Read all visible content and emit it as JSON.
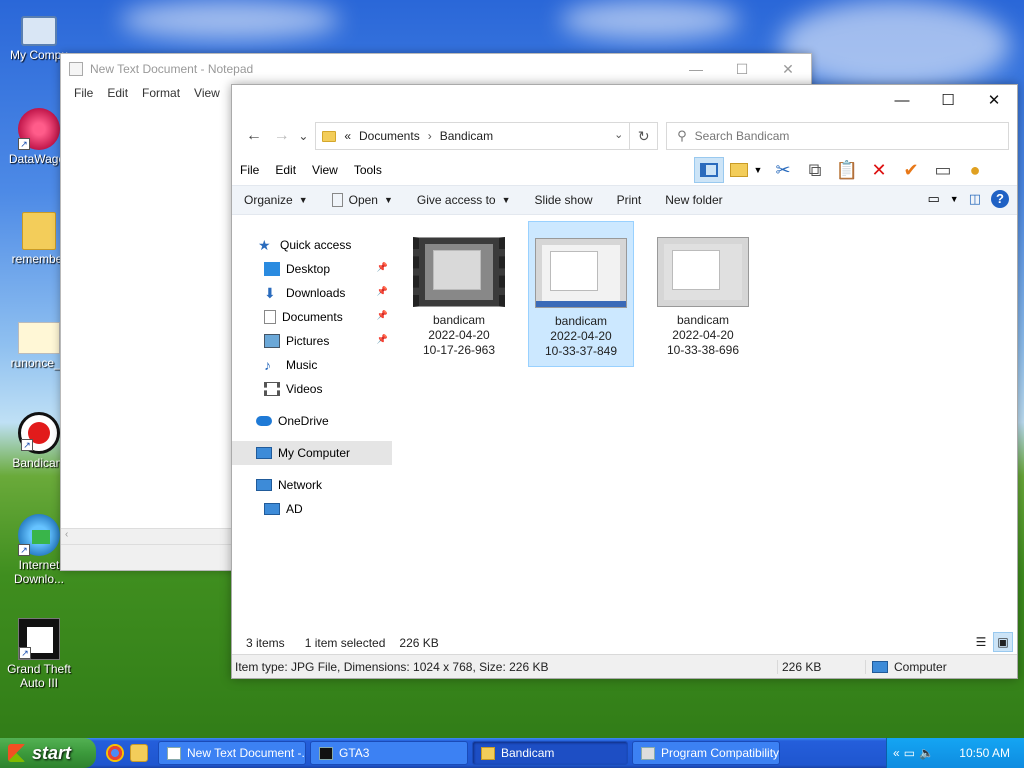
{
  "desktop": {
    "icons": [
      {
        "label": "My Compu"
      },
      {
        "label": "DataWagor"
      },
      {
        "label": "remember"
      },
      {
        "label": "runonce_5"
      },
      {
        "label": "Bandicam"
      },
      {
        "label": "Internet\nDownlo..."
      },
      {
        "label": "Grand Theft\nAuto III"
      }
    ]
  },
  "notepad": {
    "title": "New Text Document - Notepad",
    "menu": [
      "File",
      "Edit",
      "Format",
      "View",
      "H"
    ],
    "controls": {
      "minimize": "—",
      "maximize": "☐",
      "close": "✕"
    }
  },
  "explorer": {
    "controls": {
      "minimize": "—",
      "maximize": "☐",
      "close": "✕"
    },
    "nav": {
      "back": "←",
      "forward": "→",
      "recent": "⌄",
      "refresh": "↻"
    },
    "address": {
      "overflow": "«",
      "crumbs": [
        "Documents",
        "Bandicam"
      ],
      "separator": "›"
    },
    "search": {
      "placeholder": "Search Bandicam",
      "icon": "search-icon"
    },
    "menu": [
      "File",
      "Edit",
      "View",
      "Tools"
    ],
    "toolbar_icons": [
      "preview-pane-icon",
      "folder-options-icon",
      "cut-icon",
      "copy-icon",
      "paste-icon",
      "delete-icon",
      "check-icon",
      "properties-icon",
      "shell-icon"
    ],
    "commands": [
      {
        "label": "Organize",
        "dropdown": true
      },
      {
        "label": "Open",
        "dropdown": true
      },
      {
        "label": "Give access to",
        "dropdown": true
      },
      {
        "label": "Slide show",
        "dropdown": false
      },
      {
        "label": "Print",
        "dropdown": false
      },
      {
        "label": "New folder",
        "dropdown": false
      }
    ],
    "help": "?",
    "nav_pane": [
      {
        "label": "Quick access",
        "icon": "star-icon",
        "indent": 1,
        "pinned": false
      },
      {
        "label": "Desktop",
        "icon": "desktop-icon",
        "indent": 2,
        "pinned": true
      },
      {
        "label": "Downloads",
        "icon": "download-icon",
        "indent": 2,
        "pinned": true
      },
      {
        "label": "Documents",
        "icon": "document-icon",
        "indent": 2,
        "pinned": true
      },
      {
        "label": "Pictures",
        "icon": "pictures-icon",
        "indent": 2,
        "pinned": true
      },
      {
        "label": "Music",
        "icon": "music-icon",
        "indent": 2,
        "pinned": false
      },
      {
        "label": "Videos",
        "icon": "videos-icon",
        "indent": 2,
        "pinned": false
      },
      {
        "label": "OneDrive",
        "icon": "cloud-icon",
        "indent": 1,
        "pinned": false
      },
      {
        "label": "My Computer",
        "icon": "computer-icon",
        "indent": 1,
        "pinned": false,
        "selected": true
      },
      {
        "label": "Network",
        "icon": "network-icon",
        "indent": 1,
        "pinned": false
      },
      {
        "label": "AD",
        "icon": "computer-icon",
        "indent": 2,
        "pinned": false
      }
    ],
    "files": [
      {
        "line1": "bandicam",
        "line2": "2022-04-20",
        "line3": "10-17-26-963",
        "kind": "video",
        "selected": false
      },
      {
        "line1": "bandicam",
        "line2": "2022-04-20",
        "line3": "10-33-37-849",
        "kind": "image",
        "selected": true
      },
      {
        "line1": "bandicam",
        "line2": "2022-04-20",
        "line3": "10-33-38-696",
        "kind": "image",
        "selected": false
      }
    ],
    "status": {
      "items": "3 items",
      "selected": "1 item selected",
      "size": "226 KB"
    },
    "details": {
      "info": "Item type: JPG File, Dimensions: 1024 x 768, Size: 226 KB",
      "size": "226 KB",
      "location": "Computer"
    }
  },
  "taskbar": {
    "start": "start",
    "tasks": [
      {
        "label": "New Text Document -...",
        "active": false
      },
      {
        "label": "GTA3",
        "active": false
      },
      {
        "label": "Bandicam",
        "active": true
      },
      {
        "label": "Program Compatibility...",
        "active": false
      }
    ],
    "clock": "10:50 AM"
  }
}
